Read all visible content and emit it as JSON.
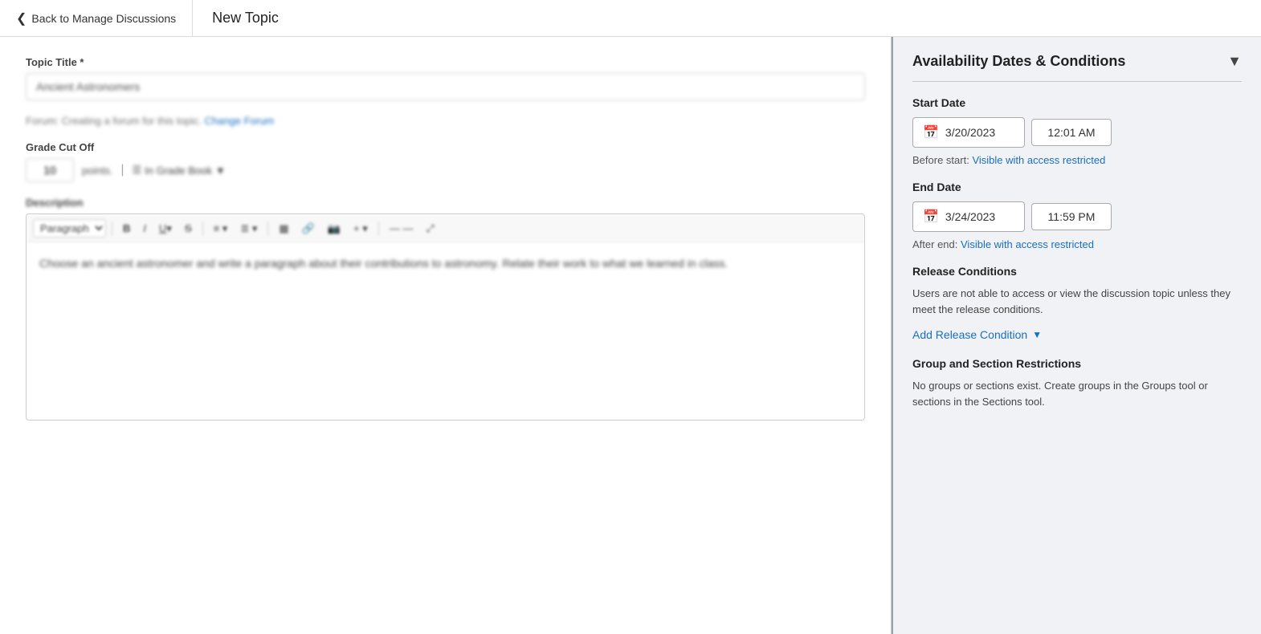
{
  "header": {
    "back_label": "Back to Manage Discussions",
    "page_title": "New Topic"
  },
  "left": {
    "topic_title_label": "Topic Title *",
    "topic_title_value": "Ancient Astronomers",
    "forum_line": "Forum: Creating a forum for this topic.",
    "forum_link": "Change Forum",
    "grade_cutoff_label": "Grade Cut Off",
    "grade_value": "10",
    "grade_points": "points.",
    "grade_book_label": "In Grade Book",
    "description_label": "Description",
    "toolbar": {
      "paragraph": "Paragraph",
      "bold": "B",
      "italic": "I",
      "underline": "U",
      "strikethrough": "S"
    },
    "editor_content": "Choose an ancient astronomer and write a paragraph about their contributions to astronomy. Relate their work to what we learned in class."
  },
  "right": {
    "card_title": "Availability Dates & Conditions",
    "start_date_label": "Start Date",
    "start_date": "3/20/2023",
    "start_time": "12:01 AM",
    "before_start_label": "Before start:",
    "before_start_link": "Visible with access restricted",
    "end_date_label": "End Date",
    "end_date": "3/24/2023",
    "end_time": "11:59 PM",
    "after_end_label": "After end:",
    "after_end_link": "Visible with access restricted",
    "release_conditions_label": "Release Conditions",
    "release_conditions_desc": "Users are not able to access or view the discussion topic unless they meet the release conditions.",
    "add_release_label": "Add Release Condition",
    "group_restrictions_label": "Group and Section Restrictions",
    "group_restrictions_desc": "No groups or sections exist. Create groups in the Groups tool or sections in the Sections tool."
  }
}
